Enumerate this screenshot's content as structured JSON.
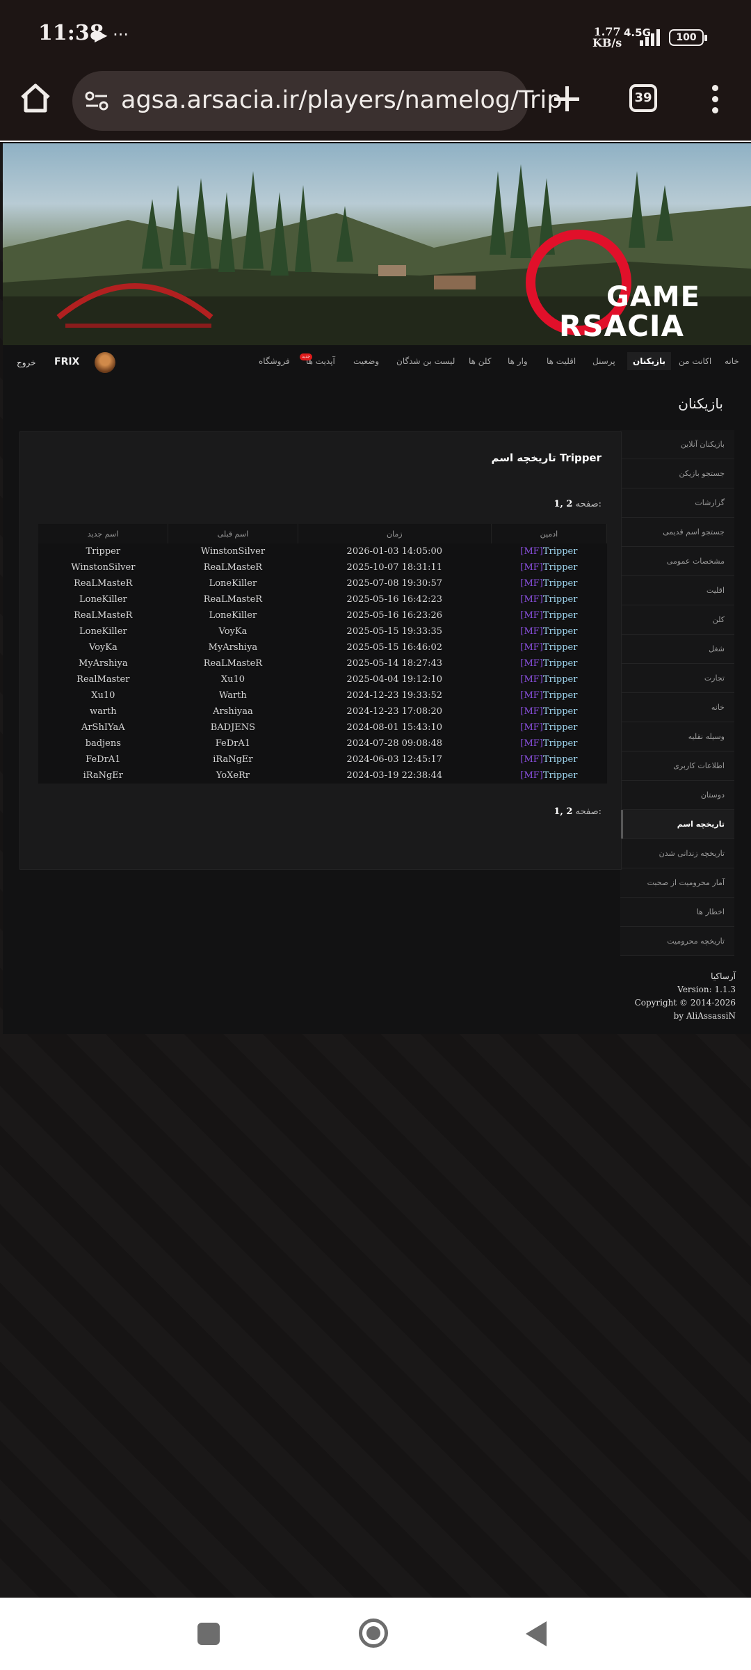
{
  "status_bar": {
    "time": "11:38",
    "icons": "▶ ···",
    "net_speed": "1.77",
    "net_unit": "KB/s",
    "signal": "4.5G",
    "battery": "100"
  },
  "browser": {
    "url": "agsa.arsacia.ir/players/namelog/Trip",
    "tab_count": "39"
  },
  "banner": {
    "logo_line1": "GAME",
    "logo_line2": "RSACIA"
  },
  "nav": {
    "items": [
      "خانه",
      "اکانت من",
      "بازیکنان",
      "پرسنل",
      "اقلیت ها",
      "وار ها",
      "کلن ها",
      "لیست بن شدگان",
      "وضعیت",
      "آپدیت ها",
      "فروشگاه"
    ],
    "active_index": 2,
    "new_badge": "جدید",
    "username": "FRIX",
    "logout": "خروج"
  },
  "section_title": "بازیکنان",
  "sidebar": {
    "items": [
      "بازیکنان آنلاین",
      "جستجو بازیکن",
      "گزارشات",
      "جستجو اسم قدیمی",
      "مشخصات عمومی",
      "اقلیت",
      "کلن",
      "شغل",
      "تجارت",
      "خانه",
      "وسیله نقلیه",
      "اطلاعات کاربری",
      "دوستان",
      "تاریخچه اسم",
      "تاریخچه زندانی شدن",
      "آمار محرومیت از صحبت",
      "اخطار ها",
      "تاریخچه محرومیت"
    ],
    "active_index": 13
  },
  "panel": {
    "title": "تاریخچه اسم Tripper",
    "pager_label": "صفحه:",
    "pager_pages": "1, 2",
    "columns": [
      "ادمین",
      "زمان",
      "اسم قبلی",
      "اسم جدید"
    ],
    "rows": [
      {
        "tag": "[MF]",
        "admin": "Tripper",
        "time": "2026-01-03 14:05:00",
        "old": "WinstonSilver",
        "new": "Tripper"
      },
      {
        "tag": "[MF]",
        "admin": "Tripper",
        "time": "2025-10-07 18:31:11",
        "old": "ReaLMasteR",
        "new": "WinstonSilver"
      },
      {
        "tag": "[MF]",
        "admin": "Tripper",
        "time": "2025-07-08 19:30:57",
        "old": "LoneKiller",
        "new": "ReaLMasteR"
      },
      {
        "tag": "[MF]",
        "admin": "Tripper",
        "time": "2025-05-16 16:42:23",
        "old": "ReaLMasteR",
        "new": "LoneKiller"
      },
      {
        "tag": "[MF]",
        "admin": "Tripper",
        "time": "2025-05-16 16:23:26",
        "old": "LoneKiller",
        "new": "ReaLMasteR"
      },
      {
        "tag": "[MF]",
        "admin": "Tripper",
        "time": "2025-05-15 19:33:35",
        "old": "VoyKa",
        "new": "LoneKiller"
      },
      {
        "tag": "[MF]",
        "admin": "Tripper",
        "time": "2025-05-15 16:46:02",
        "old": "MyArshiya",
        "new": "VoyKa"
      },
      {
        "tag": "[MF]",
        "admin": "Tripper",
        "time": "2025-05-14 18:27:43",
        "old": "ReaLMasteR",
        "new": "MyArshiya"
      },
      {
        "tag": "[MF]",
        "admin": "Tripper",
        "time": "2025-04-04 19:12:10",
        "old": "Xu10",
        "new": "RealMaster"
      },
      {
        "tag": "[MF]",
        "admin": "Tripper",
        "time": "2024-12-23 19:33:52",
        "old": "Warth",
        "new": "Xu10"
      },
      {
        "tag": "[MF]",
        "admin": "Tripper",
        "time": "2024-12-23 17:08:20",
        "old": "Arshiyaa",
        "new": "warth"
      },
      {
        "tag": "[MF]",
        "admin": "Tripper",
        "time": "2024-08-01 15:43:10",
        "old": "BADJENS",
        "new": "ArShIYaA"
      },
      {
        "tag": "[MF]",
        "admin": "Tripper",
        "time": "2024-07-28 09:08:48",
        "old": "FeDrA1",
        "new": "badjens"
      },
      {
        "tag": "[MF]",
        "admin": "Tripper",
        "time": "2024-06-03 12:45:17",
        "old": "iRaNgEr",
        "new": "FeDrA1"
      },
      {
        "tag": "[MF]",
        "admin": "Tripper",
        "time": "2024-03-19 22:38:44",
        "old": "YoXeRr",
        "new": "iRaNgEr"
      }
    ]
  },
  "footer": {
    "brand": "آرساکیا",
    "version": "Version: 1.1.3",
    "copyright": "Copyright © 2014-2026",
    "author": "by AliAssassiN"
  },
  "colors": {
    "admin_tag": "#8a4fe0",
    "admin_name": "#9fd6f0",
    "logo_red": "#e1102a"
  }
}
